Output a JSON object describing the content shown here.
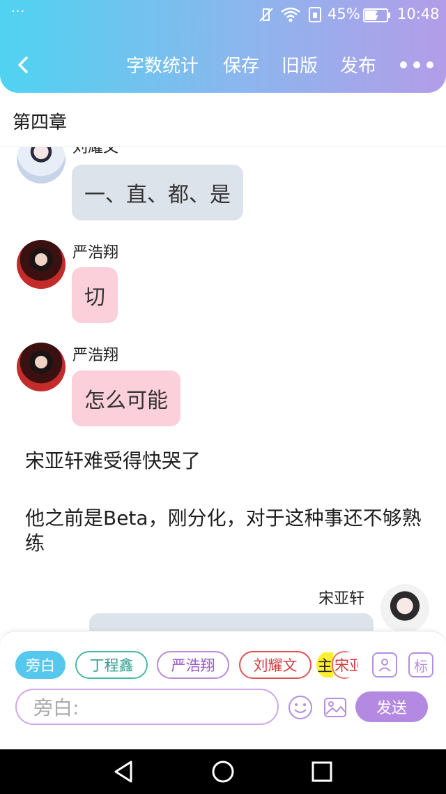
{
  "status_bar": {
    "menu_dots": "···",
    "battery_percent": "45%",
    "time": "10:48"
  },
  "toolbar": {
    "word_count": "字数统计",
    "save": "保存",
    "old_version": "旧版",
    "publish": "发布"
  },
  "chapter_title": "第四章",
  "messages": [
    {
      "speaker": "刘耀文",
      "text": "一、直、都、是"
    },
    {
      "speaker": "严浩翔",
      "text": "切"
    },
    {
      "speaker": "严浩翔",
      "text": "怎么可能"
    }
  ],
  "narration": [
    "宋亚轩难受得快哭了",
    "他之前是Beta，刚分化，对于这种事还不够熟练"
  ],
  "last_message": {
    "speaker": "宋亚轩"
  },
  "composer": {
    "chips": [
      "旁白",
      "丁程鑫",
      "严浩翔",
      "刘耀文"
    ],
    "chip_partial_highlight": "主",
    "chip_partial_name": "宋亚",
    "role_icon_label": "标",
    "input_placeholder": "旁白:",
    "send_label": "发送"
  }
}
